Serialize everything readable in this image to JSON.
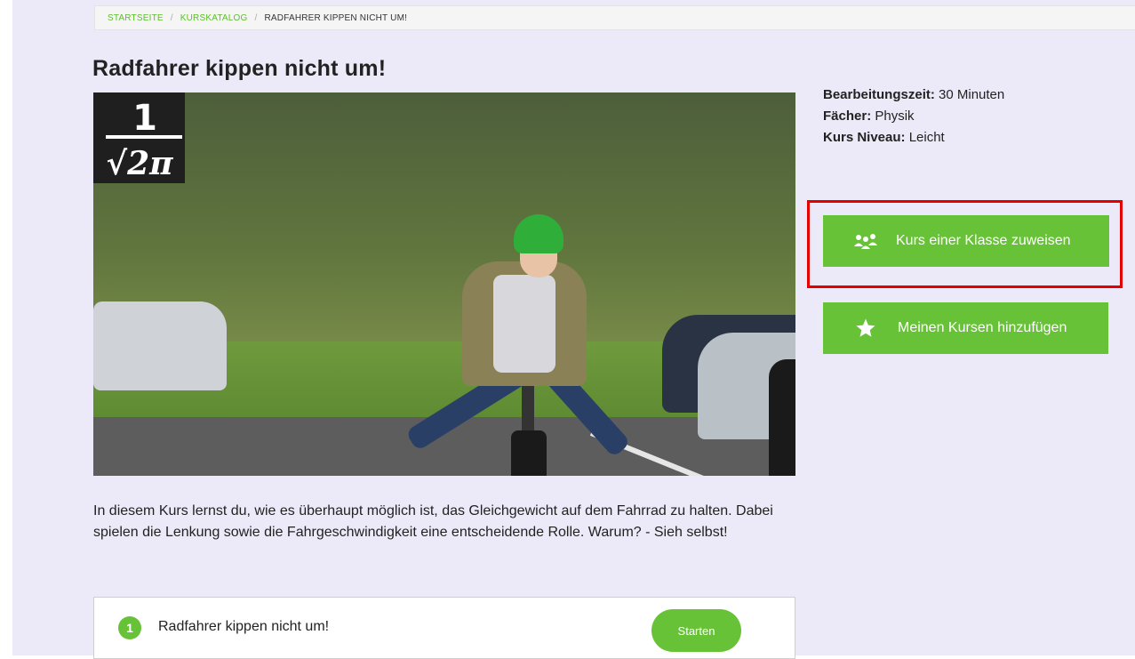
{
  "breadcrumb": {
    "items": [
      "STARTSEITE",
      "KURSKATALOG"
    ],
    "separator": "/",
    "current": "RADFAHRER KIPPEN NICHT UM!"
  },
  "course": {
    "title": "Radfahrer kippen nicht um!",
    "logo_formula": {
      "numerator": "1",
      "denominator": "√2π"
    },
    "meta": {
      "duration_label": "Bearbeitungszeit:",
      "duration_value": " 30 Minuten",
      "subjects_label": "Fächer:",
      "subjects_value": " Physik",
      "level_label": "Kurs Niveau:",
      "level_value": " Leicht"
    },
    "description": "In diesem Kurs lernst du, wie es überhaupt möglich ist, das Gleichgewicht auf dem Fahrrad zu halten. Dabei spielen die Lenkung sowie die Fahrgeschwindigkeit eine entscheidende Rolle. Warum? - Sieh selbst!"
  },
  "actions": {
    "assign_label": "Kurs einer Klasse zuweisen",
    "assign_icon": "group-icon",
    "add_label": "Meinen Kursen hinzufügen",
    "add_icon": "star-icon"
  },
  "lessons": [
    {
      "number": "1",
      "title": "Radfahrer kippen nicht um!",
      "action_label": "Starten"
    }
  ],
  "colors": {
    "accent_green": "#67c237",
    "link_green": "#5cbf2a",
    "highlight_red": "#e50000",
    "page_background": "#eceaf8"
  }
}
